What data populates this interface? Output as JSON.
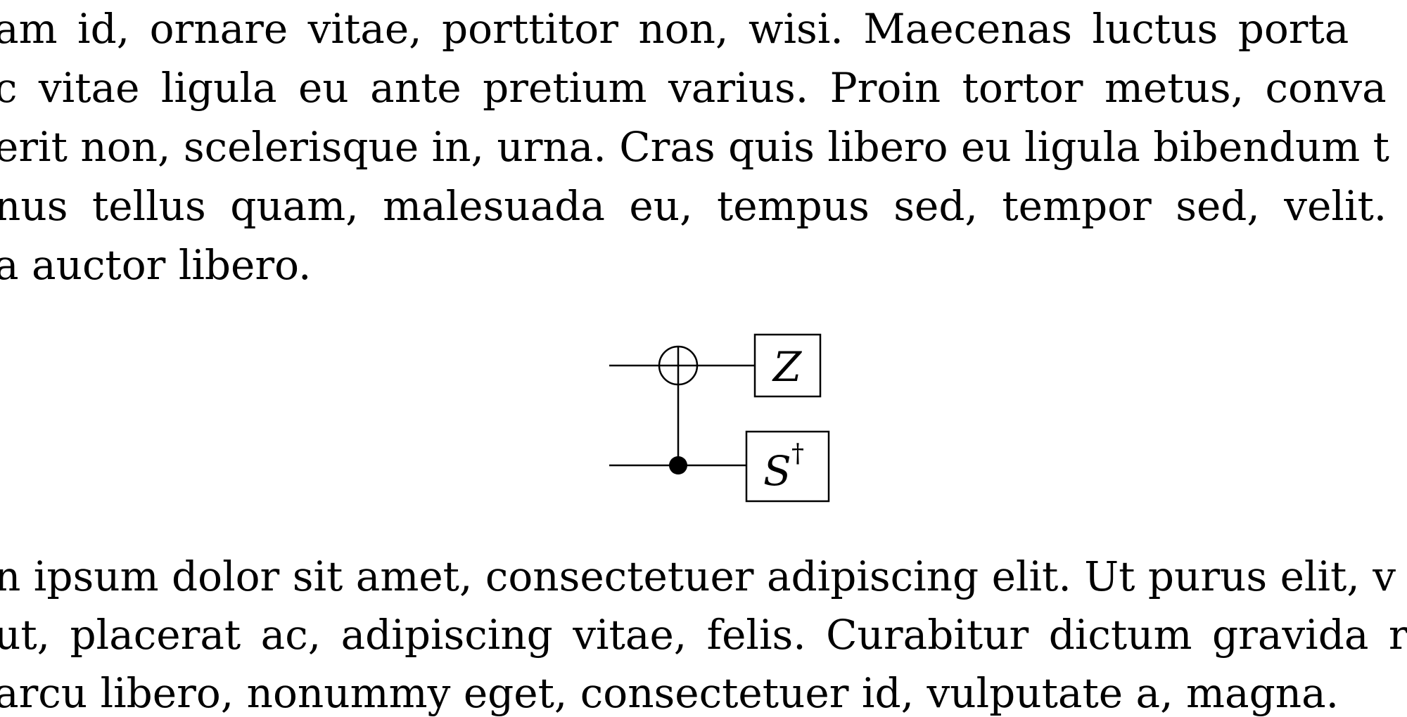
{
  "top_paragraph": {
    "lines": [
      "am id, ornare vitae, porttitor non, wisi.  Maecenas luctus porta",
      "c vitae ligula eu ante pretium varius.  Proin tortor metus, conva",
      "erit non, scelerisque in, urna. Cras quis libero eu ligula bibendum t",
      "nus tellus quam, malesuada eu, tempus sed, tempor sed, velit.",
      "a auctor libero."
    ]
  },
  "circuit": {
    "gate_top_label": "Z",
    "gate_bottom_label": "S",
    "gate_bottom_superscript": "†"
  },
  "bottom_paragraph": {
    "lines": [
      "n ipsum dolor sit amet, consectetuer adipiscing elit. Ut purus elit, v",
      "ut, placerat ac, adipiscing vitae, felis.  Curabitur dictum gravida r",
      "arcu libero, nonummy eget, consectetuer id, vulputate a, magna."
    ]
  }
}
